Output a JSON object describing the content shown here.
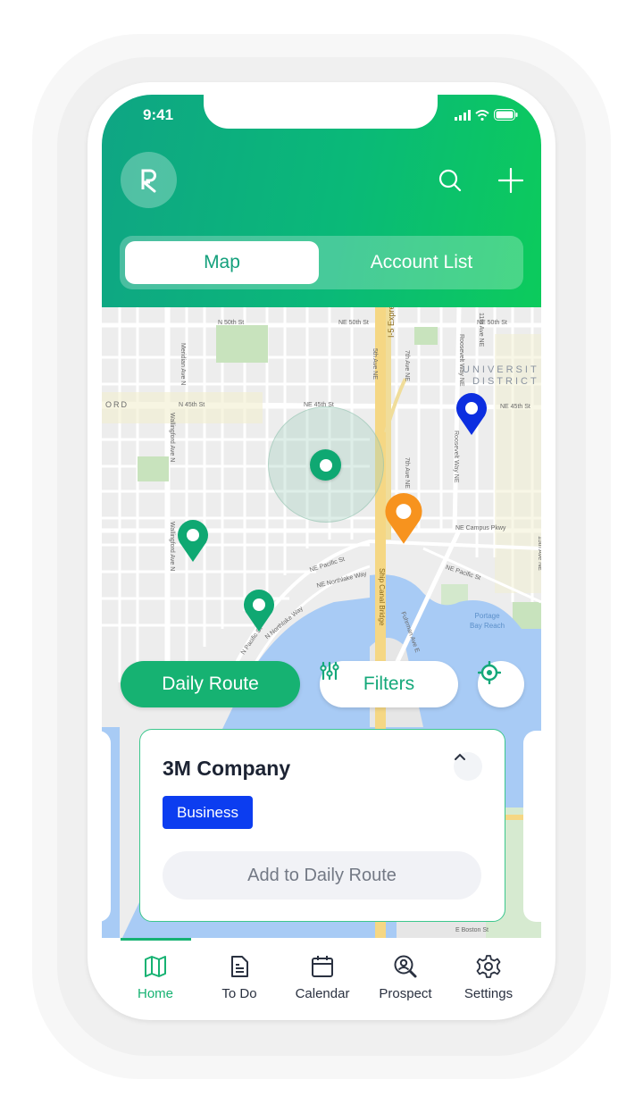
{
  "status_bar": {
    "time": "9:41"
  },
  "header": {
    "logo_letter": "R",
    "search_icon": "search-icon",
    "add_icon": "plus-icon"
  },
  "segmented_control": {
    "tabs": [
      {
        "label": "Map",
        "active": true
      },
      {
        "label": "Account List",
        "active": false
      }
    ]
  },
  "map": {
    "area_labels": [
      "ORD"
    ],
    "district_label": [
      "UNIVERSIT",
      "DISTRICT"
    ],
    "water_label": [
      "Portage",
      "Bay Reach"
    ],
    "road_labels": {
      "n50th": "N 50th St",
      "ne50th": "NE 50th St",
      "ne50th_b": "NE 50th St",
      "n45th": "N 45th St",
      "ne45th": "NE 45th St",
      "ne45th_b": "NE 45th St",
      "meridian": "Meridian Ave N",
      "wallingford": "Wallingford Ave N",
      "fifth": "5th Ave NE",
      "seventh": "7th Ave NE",
      "seventh_b": "7th Ave NE",
      "i5": "I-5 Express",
      "roosevelt": "Roosevelt Way NE",
      "roosevelt_b": "Roosevelt Way NE",
      "eleventh": "11th Ave NE",
      "fifteenth": "15th Ave NE",
      "campus": "NE Campus Pkwy",
      "pacific": "NE Pacific St",
      "pacific_b": "NE Pacific St",
      "northlake": "NE Northlake Way",
      "n_northlake": "N Northlake Way",
      "n_pacific": "N Pacific St",
      "shipcanal": "Ship Canal Bridge",
      "fuhrman": "Fuhrman Ave E",
      "boston": "E Boston St"
    },
    "pins": [
      {
        "color": "#0c2ee0",
        "kind": "blue"
      },
      {
        "color": "#0fa872",
        "kind": "selected-center"
      },
      {
        "color": "#f7931e",
        "kind": "orange"
      },
      {
        "color": "#0fa872",
        "kind": "green"
      },
      {
        "color": "#0fa872",
        "kind": "green"
      }
    ]
  },
  "map_controls": {
    "daily_route_label": "Daily Route",
    "filters_label": "Filters",
    "locate_icon": "crosshair-icon"
  },
  "account_card": {
    "name": "3M Company",
    "badge": "Business",
    "badge_color": "#0c3df0",
    "action_label": "Add to Daily Route"
  },
  "tab_bar": {
    "items": [
      {
        "label": "Home",
        "icon": "map-icon",
        "active": true
      },
      {
        "label": "To Do",
        "icon": "document-icon",
        "active": false
      },
      {
        "label": "Calendar",
        "icon": "calendar-icon",
        "active": false
      },
      {
        "label": "Prospect",
        "icon": "prospect-search-icon",
        "active": false
      },
      {
        "label": "Settings",
        "icon": "gear-icon",
        "active": false
      }
    ]
  },
  "colors": {
    "brand_green": "#16b272",
    "header_gradient_start": "#0fa584",
    "header_gradient_end": "#0ccb5c",
    "text_dark": "#1c2333"
  }
}
